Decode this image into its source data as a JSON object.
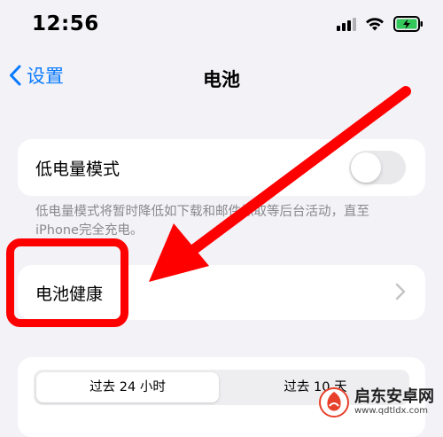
{
  "status_bar": {
    "time": "12:56",
    "battery_color": "#34c759"
  },
  "nav": {
    "back_label": "设置",
    "title": "电池",
    "accent_color": "#0a7aff"
  },
  "low_power": {
    "label": "低电量模式",
    "enabled": false,
    "footnote": "低电量模式将暂时降低如下载和邮件抓取等后台活动，直至iPhone完全充电。"
  },
  "battery_health": {
    "label": "电池健康"
  },
  "range_selector": {
    "options": [
      "过去 24 小时",
      "过去 10 天"
    ],
    "selected_index": 0
  },
  "annotation": {
    "color": "#ff0000"
  },
  "watermark": {
    "name": "启东安卓网",
    "url": "www.qdtldx.com"
  }
}
